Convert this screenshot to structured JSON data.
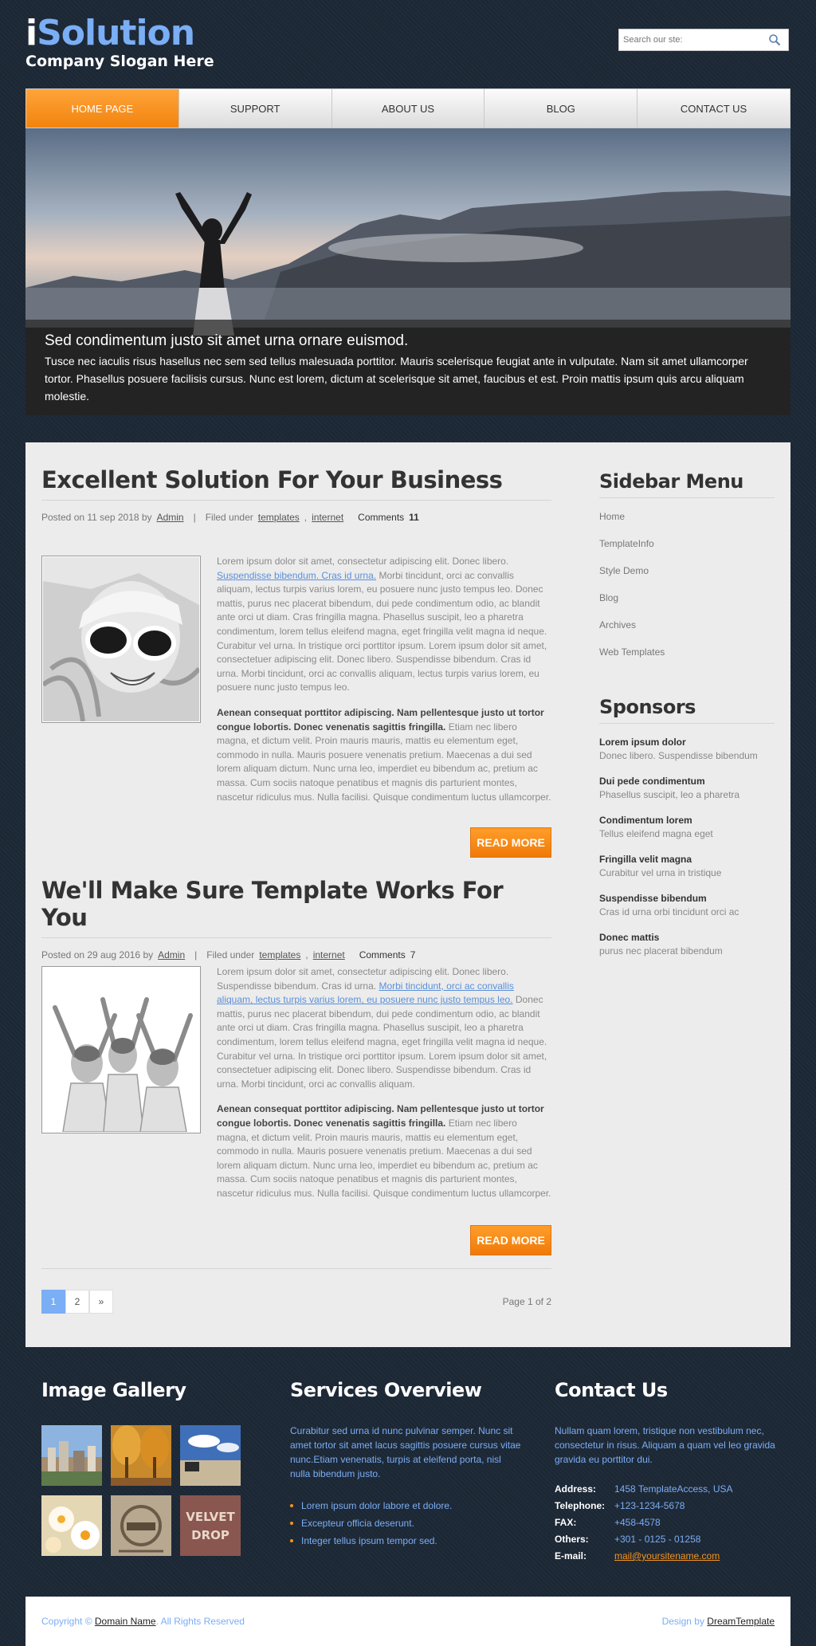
{
  "header": {
    "logo_first": "i",
    "logo_rest": "Solution",
    "slogan": "Company Slogan Here",
    "search_placeholder": "Search our ste:"
  },
  "nav": [
    {
      "label": "HOME PAGE",
      "active": true
    },
    {
      "label": "SUPPORT"
    },
    {
      "label": "ABOUT US"
    },
    {
      "label": "BLOG"
    },
    {
      "label": "CONTACT US"
    }
  ],
  "hero": {
    "title": "Sed condimentum justo sit amet urna ornare euismod.",
    "text": "Tusce nec iaculis risus hasellus nec sem sed tellus malesuada porttitor. Mauris scelerisque feugiat ante in vulputate. Nam sit amet ullamcorper tortor. Phasellus posuere facilisis cursus. Nunc est lorem, dictum at scelerisque sit amet, faucibus et est. Proin mattis ipsum quis arcu aliquam molestie."
  },
  "posts": [
    {
      "title": "Excellent Solution For Your Business",
      "posted_on": "Posted on 11 sep 2018 by",
      "author": "Admin",
      "filed": "Filed under",
      "cat1": "templates",
      "cat2": "internet",
      "comments_label": "Comments",
      "comments": "11",
      "p1_a": "Lorem ipsum dolor sit amet, consectetur adipiscing elit. Donec libero.",
      "p1_link": "Suspendisse bibendum. Cras id urna.",
      "p1_b": "Morbi tincidunt, orci ac convallis aliquam, lectus turpis varius lorem, eu posuere nunc justo tempus leo. Donec mattis, purus nec placerat bibendum, dui pede condimentum odio, ac blandit ante orci ut diam. Cras fringilla magna. Phasellus suscipit, leo a pharetra condimentum, lorem tellus eleifend magna, eget fringilla velit magna id neque. Curabitur vel urna. In tristique orci porttitor ipsum. Lorem ipsum dolor sit amet, consectetuer adipiscing elit. Donec libero. Suspendisse bibendum. Cras id urna. Morbi tincidunt, orci ac convallis aliquam, lectus turpis varius lorem, eu posuere nunc justo tempus leo.",
      "p2_bold": "Aenean consequat porttitor adipiscing. Nam pellentesque justo ut tortor congue lobortis. Donec venenatis sagittis fringilla.",
      "p2": "Etiam nec libero magna, et dictum velit. Proin mauris mauris, mattis eu elementum eget, commodo in nulla. Mauris posuere venenatis pretium. Maecenas a dui sed lorem aliquam dictum. Nunc urna leo, imperdiet eu bibendum ac, pretium ac massa. Cum sociis natoque penatibus et magnis dis parturient montes, nascetur ridiculus mus. Nulla facilisi. Quisque condimentum luctus ullamcorper.",
      "read_more": "READ MORE"
    },
    {
      "title": "We'll Make Sure Template Works For You",
      "posted_on": "Posted on 29 aug 2016 by",
      "author": "Admin",
      "filed": "Filed under",
      "cat1": "templates",
      "cat2": "internet",
      "comments_label": "Comments",
      "comments": "7",
      "p1_a": "Lorem ipsum dolor sit amet, consectetur adipiscing elit. Donec libero. Suspendisse bibendum. Cras id urna.",
      "p1_link": "Morbi tincidunt, orci ac convallis aliquam, lectus turpis varius lorem, eu posuere nunc justo tempus leo.",
      "p1_b": "Donec mattis, purus nec placerat bibendum, dui pede condimentum odio, ac blandit ante orci ut diam. Cras fringilla magna. Phasellus suscipit, leo a pharetra condimentum, lorem tellus eleifend magna, eget fringilla velit magna id neque. Curabitur vel urna. In tristique orci porttitor ipsum. Lorem ipsum dolor sit amet, consectetuer adipiscing elit. Donec libero. Suspendisse bibendum. Cras id urna. Morbi tincidunt, orci ac convallis aliquam.",
      "p2_bold": "Aenean consequat porttitor adipiscing. Nam pellentesque justo ut tortor congue lobortis. Donec venenatis sagittis fringilla.",
      "p2": "Etiam nec libero magna, et dictum velit. Proin mauris mauris, mattis eu elementum eget, commodo in nulla. Mauris posuere venenatis pretium. Maecenas a dui sed lorem aliquam dictum. Nunc urna leo, imperdiet eu bibendum ac, pretium ac massa. Cum sociis natoque penatibus et magnis dis parturient montes, nascetur ridiculus mus. Nulla facilisi. Quisque condimentum luctus ullamcorper.",
      "read_more": "READ MORE"
    }
  ],
  "pager": {
    "pages": [
      "1",
      "2",
      "»"
    ],
    "page_of": "Page 1 of 2"
  },
  "sidebar": {
    "menu_title": "Sidebar Menu",
    "menu": [
      "Home",
      "TemplateInfo",
      "Style Demo",
      "Blog",
      "Archives",
      "Web Templates"
    ],
    "sponsors_title": "Sponsors",
    "sponsors": [
      {
        "name": "Lorem ipsum dolor",
        "desc": "Donec libero. Suspendisse bibendum"
      },
      {
        "name": "Dui pede condimentum",
        "desc": "Phasellus suscipit, leo a pharetra"
      },
      {
        "name": "Condimentum lorem",
        "desc": "Tellus eleifend magna eget"
      },
      {
        "name": "Fringilla velit magna",
        "desc": "Curabitur vel urna in tristique"
      },
      {
        "name": "Suspendisse bibendum",
        "desc": "Cras id urna orbi tincidunt orci ac"
      },
      {
        "name": "Donec mattis",
        "desc": "purus nec placerat bibendum"
      }
    ]
  },
  "footer": {
    "gallery_title": "Image Gallery",
    "services_title": "Services Overview",
    "services_text": "Curabitur sed urna id nunc pulvinar semper. Nunc sit amet tortor sit amet lacus sagittis posuere cursus vitae nunc.Etiam venenatis, turpis at eleifend porta, nisl nulla bibendum justo.",
    "services_list": [
      "Lorem ipsum dolor labore et dolore.",
      "Excepteur officia deserunt.",
      "Integer tellus ipsum tempor sed."
    ],
    "contact_title": "Contact Us",
    "contact_text": "Nullam quam lorem, tristique non vestibulum nec, consectetur in risus. Aliquam a quam vel leo gravida gravida eu porttitor dui.",
    "contact": [
      {
        "label": "Address:",
        "value": "1458 TemplateAccess, USA"
      },
      {
        "label": "Telephone:",
        "value": "+123-1234-5678"
      },
      {
        "label": "FAX:",
        "value": "+458-4578"
      },
      {
        "label": "Others:",
        "value": "+301 - 0125 - 01258"
      },
      {
        "label": "E-mail:",
        "value": "mail@yoursitename.com"
      }
    ]
  },
  "bottom": {
    "copy_prefix": "Copyright ©",
    "domain": "Domain Name",
    "copy_suffix": ". All Rights Reserved",
    "design_prefix": "Design by",
    "design_link": "DreamTemplate"
  },
  "colors": {
    "accent": "#f7941d",
    "blue": "#7aaef5",
    "background": "#1d2836"
  }
}
